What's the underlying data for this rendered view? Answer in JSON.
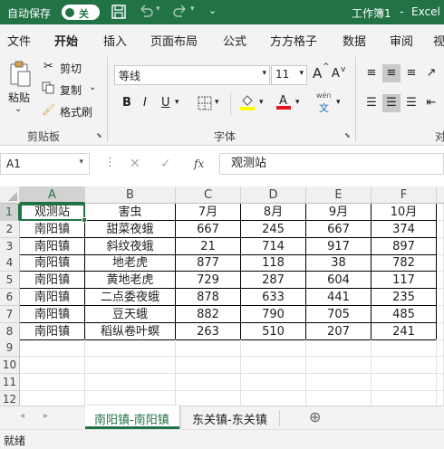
{
  "titlebar": {
    "autosave_label": "自动保存",
    "autosave_state": "关",
    "document_title": "工作簿1",
    "separator": "-",
    "app_name": "Excel"
  },
  "ribbon_tabs": [
    "文件",
    "开始",
    "插入",
    "页面布局",
    "公式",
    "方方格子",
    "数据",
    "审阅",
    "视"
  ],
  "active_tab": "开始",
  "clipboard": {
    "paste": "粘贴",
    "cut": "剪切",
    "copy": "复制",
    "format_painter": "格式刷",
    "group": "剪贴板"
  },
  "font_group": {
    "font_name": "等线",
    "font_size": "11",
    "group": "字体",
    "bold": "B",
    "italic": "I",
    "underline": "U",
    "increase_size": "A",
    "decrease_size": "A",
    "phonetic_top": "wén",
    "phonetic_bottom": "文",
    "fill_color": "#ffff00",
    "font_color": "#e81123",
    "more": "对"
  },
  "formula_bar": {
    "name_box": "A1",
    "fx": "fx",
    "content": "观测站"
  },
  "grid": {
    "columns": [
      "A",
      "B",
      "C",
      "D",
      "E",
      "F"
    ],
    "row_numbers": [
      "1",
      "2",
      "3",
      "4",
      "5",
      "6",
      "7",
      "8",
      "9",
      "10",
      "11",
      "12"
    ],
    "header_row": [
      "观测站",
      "害虫",
      "7月",
      "8月",
      "9月",
      "10月"
    ],
    "rows": [
      [
        "南阳镇",
        "甜菜夜蛾",
        "667",
        "245",
        "667",
        "374"
      ],
      [
        "南阳镇",
        "斜纹夜蛾",
        "21",
        "714",
        "917",
        "897"
      ],
      [
        "南阳镇",
        "地老虎",
        "877",
        "118",
        "38",
        "782"
      ],
      [
        "南阳镇",
        "黄地老虎",
        "729",
        "287",
        "604",
        "117"
      ],
      [
        "南阳镇",
        "二点委夜蛾",
        "878",
        "633",
        "441",
        "235"
      ],
      [
        "南阳镇",
        "豆天蛾",
        "882",
        "790",
        "705",
        "485"
      ],
      [
        "南阳镇",
        "稻纵卷叶螟",
        "263",
        "510",
        "207",
        "241"
      ]
    ],
    "selected_cell": "A1",
    "accent": "#217346"
  },
  "sheets": [
    "南阳镇-南阳镇",
    "东关镇-东关镇"
  ],
  "active_sheet": "南阳镇-南阳镇",
  "status": "就绪"
}
